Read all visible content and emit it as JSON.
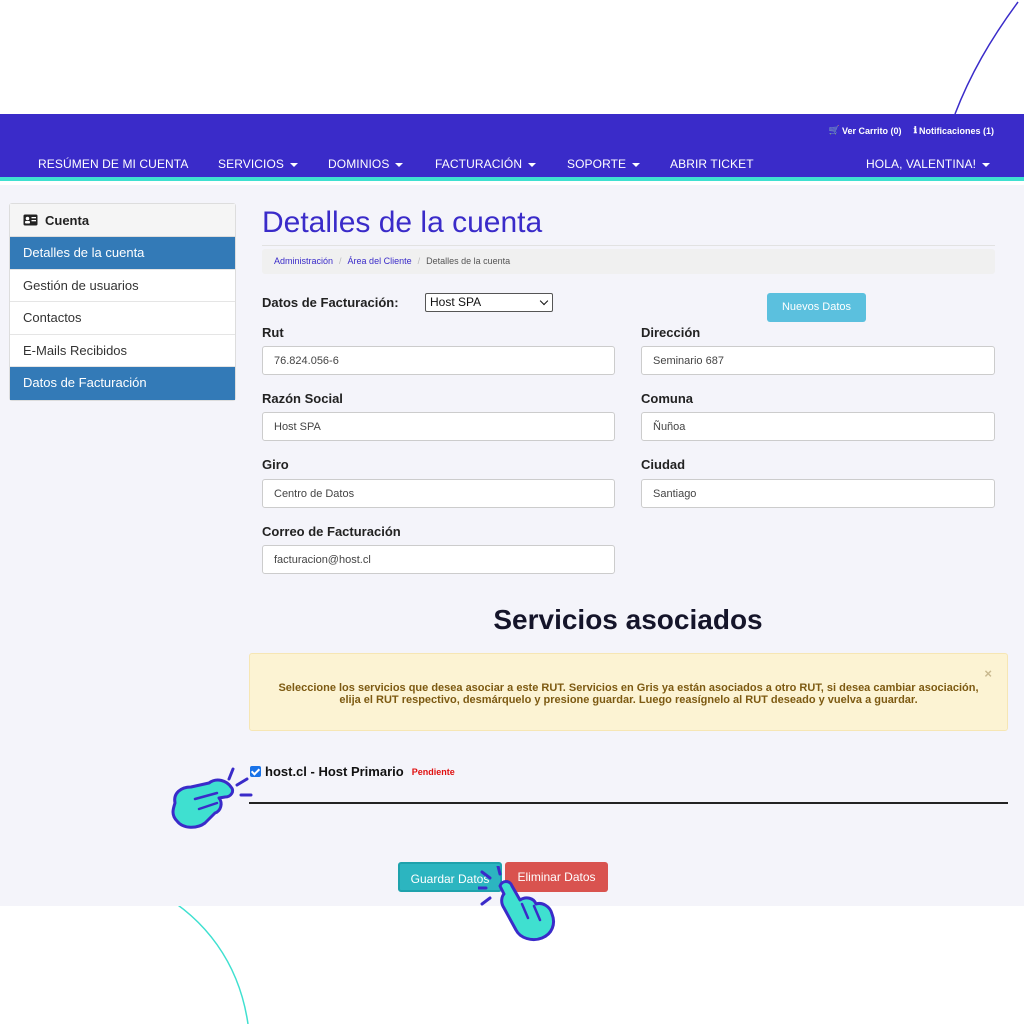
{
  "topbar": {
    "cart": "Ver Carrito (0)",
    "notifications": "Notificaciones (1)"
  },
  "nav": {
    "items": [
      "RESÚMEN DE MI CUENTA",
      "SERVICIOS",
      "DOMINIOS",
      "FACTURACIÓN",
      "SOPORTE",
      "ABRIR TICKET"
    ],
    "user": "HOLA, VALENTINA!"
  },
  "sidebar": {
    "header": "Cuenta",
    "items": [
      "Detalles de la cuenta",
      "Gestión de usuarios",
      "Contactos",
      "E-Mails Recibidos",
      "Datos de Facturación"
    ]
  },
  "page": {
    "title": "Detalles de la cuenta",
    "breadcrumb": [
      "Administración",
      "Área del Cliente",
      "Detalles de la cuenta"
    ]
  },
  "billing": {
    "select_label": "Datos de Facturación:",
    "selected": "Host SPA",
    "new_button": "Nuevos Datos",
    "fields": {
      "rut_label": "Rut",
      "rut_value": "76.824.056-6",
      "direccion_label": "Dirección",
      "direccion_value": "Seminario 687",
      "razon_label": "Razón Social",
      "razon_value": "Host SPA",
      "comuna_label": "Comuna",
      "comuna_value": "Ñuñoa",
      "giro_label": "Giro",
      "giro_value": "Centro de Datos",
      "ciudad_label": "Ciudad",
      "ciudad_value": "Santiago",
      "correo_label": "Correo de Facturación",
      "correo_value": "facturacion@host.cl"
    }
  },
  "services": {
    "title": "Servicios asociados",
    "alert": "Seleccione los servicios que desea asociar a este RUT. Servicios en Gris ya están asociados a otro RUT, si desea cambiar asociación, elija el RUT respectivo, desmárquelo y presione guardar. Luego reasígnelo al RUT deseado y vuelva a guardar.",
    "alert_close": "×",
    "item_name": "host.cl - Host Primario",
    "item_status": "Pendiente",
    "item_checked": true
  },
  "actions": {
    "save": "Guardar Datos",
    "delete": "Eliminar Datos"
  },
  "colors": {
    "brand": "#3a2bc9",
    "accent": "#3fe0d0",
    "active": "#337ab7",
    "save": "#2cb5c0",
    "delete": "#d9534f"
  }
}
